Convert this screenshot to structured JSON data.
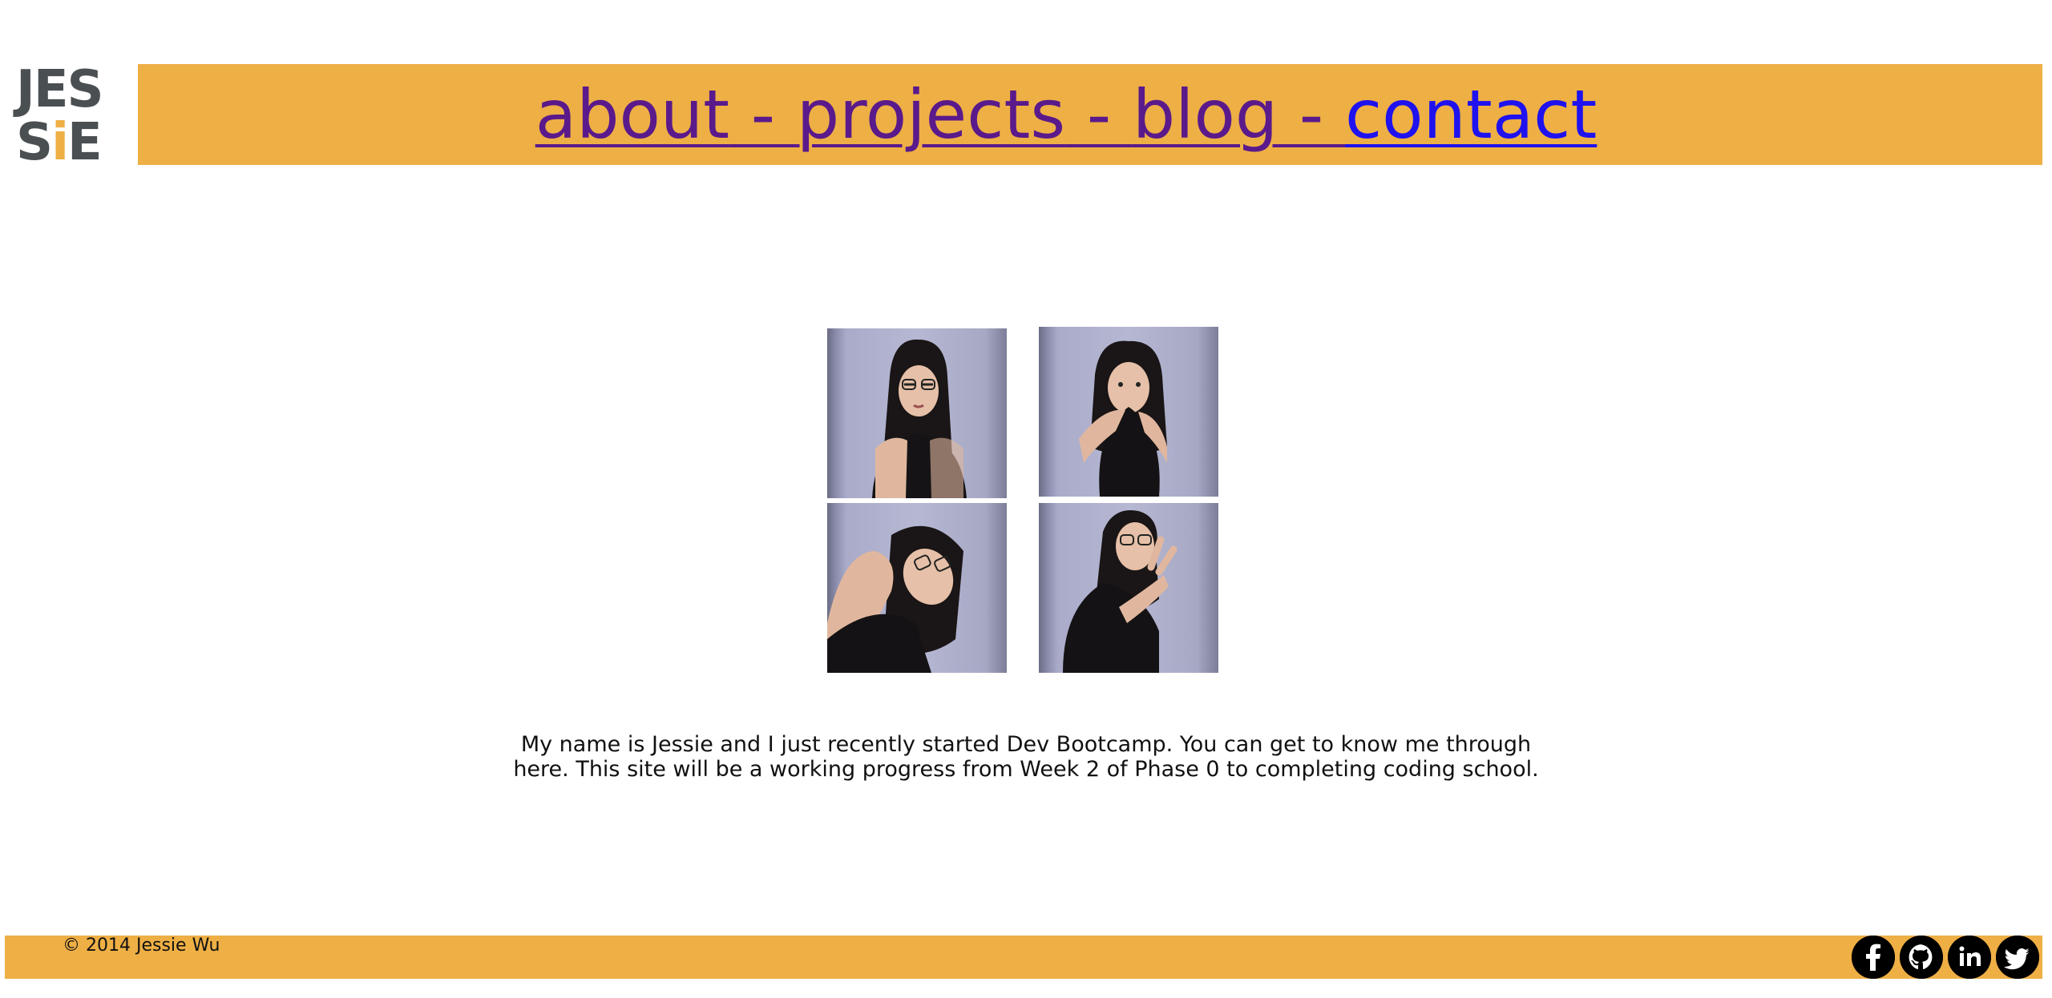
{
  "logo": {
    "line1": "JES",
    "line2_prefix": "S",
    "line2_accent": "i",
    "line2_suffix": "E"
  },
  "nav": {
    "items": [
      {
        "label": "about"
      },
      {
        "label": "projects"
      },
      {
        "label": "blog"
      },
      {
        "label": "contact"
      }
    ],
    "separator": " - "
  },
  "photos": [
    {
      "alt": "Jessie portrait 1"
    },
    {
      "alt": "Jessie portrait 2"
    },
    {
      "alt": "Jessie portrait 3"
    },
    {
      "alt": "Jessie portrait 4"
    }
  ],
  "bio": {
    "line1": "My name is Jessie and I just recently started Dev Bootcamp. You can get to know me through",
    "line2": "here. This site will be a working progress from Week 2 of Phase 0 to completing coding school."
  },
  "footer": {
    "copyright": "© 2014 Jessie Wu",
    "social": [
      {
        "icon": "facebook-icon",
        "glyph": "f"
      },
      {
        "icon": "github-icon",
        "glyph": "⌥"
      },
      {
        "icon": "linkedin-icon",
        "glyph": "in"
      },
      {
        "icon": "twitter-icon",
        "glyph": "t"
      }
    ]
  },
  "colors": {
    "accent": "#eeaf45",
    "visited_link": "#5a1a8b",
    "active_link": "#1f12ee",
    "logo_gray": "#4a4f52"
  }
}
